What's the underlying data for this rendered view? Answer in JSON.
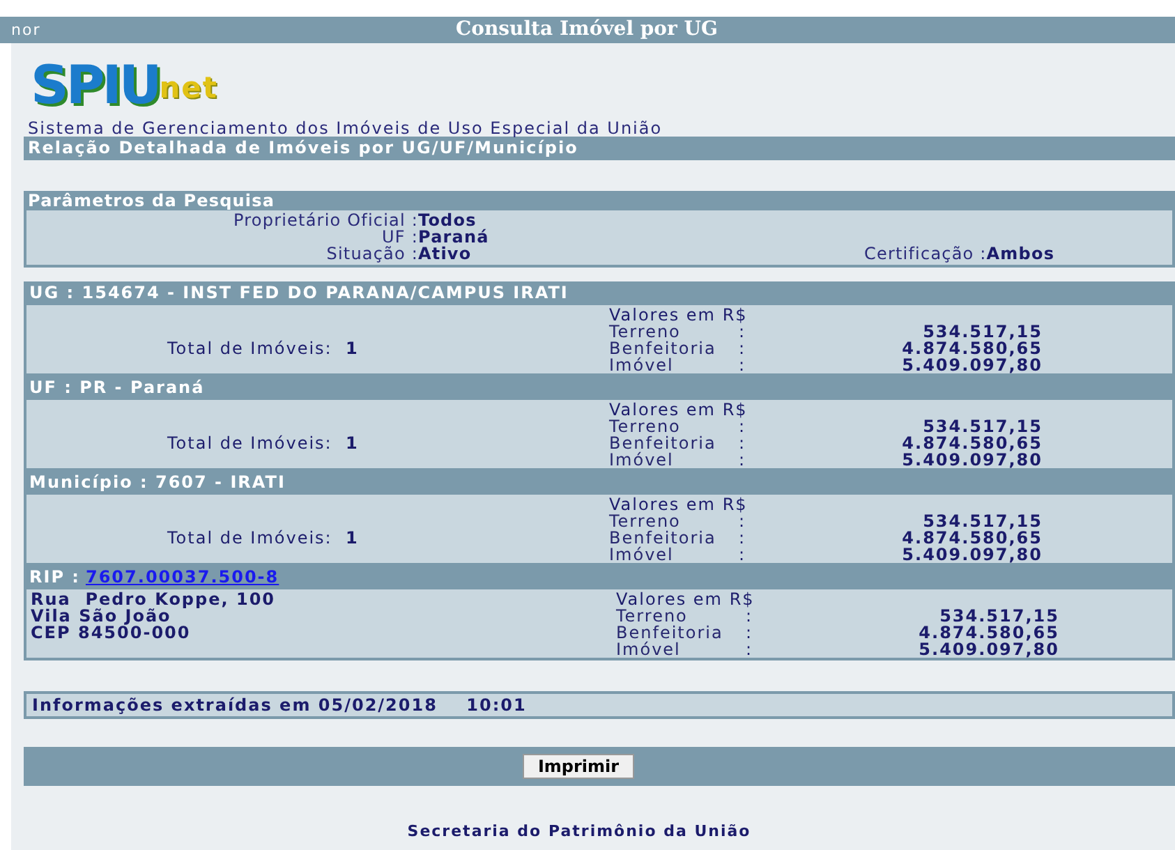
{
  "window": {
    "title_left": "nor",
    "title": "Consulta Imóvel por UG"
  },
  "logo": {
    "main": "SPIU",
    "suffix": "net"
  },
  "system_name": "Sistema de Gerenciamento dos Imóveis de Uso Especial da União",
  "report_title": "Relação Detalhada de Imóveis por UG/UF/Município",
  "parameters": {
    "title": "Parâmetros da Pesquisa",
    "fields": [
      {
        "label": "Proprietário Oficial :",
        "value": "Todos"
      },
      {
        "label": "UF :",
        "value": "Paraná"
      },
      {
        "label": "Situação :",
        "value": "Ativo"
      }
    ],
    "certification": {
      "label": "Certificação :",
      "value": "Ambos"
    }
  },
  "groups": [
    {
      "kind": "summary",
      "heading": "UG : 154674 - INST FED DO PARANA/CAMPUS IRATI",
      "total_label": "Total de Imóveis:",
      "total": "1",
      "values_title": "Valores em R$",
      "values": [
        {
          "label": "Terreno",
          "sep": ":",
          "value": "534.517,15"
        },
        {
          "label": "Benfeitoria",
          "sep": ":",
          "value": "4.874.580,65"
        },
        {
          "label": "Imóvel",
          "sep": ":",
          "value": "5.409.097,80"
        }
      ]
    },
    {
      "kind": "summary",
      "heading": "UF : PR - Paraná",
      "total_label": "Total de Imóveis:",
      "total": "1",
      "values_title": "Valores em R$",
      "values": [
        {
          "label": "Terreno",
          "sep": ":",
          "value": "534.517,15"
        },
        {
          "label": "Benfeitoria",
          "sep": ":",
          "value": "4.874.580,65"
        },
        {
          "label": "Imóvel",
          "sep": ":",
          "value": "5.409.097,80"
        }
      ]
    },
    {
      "kind": "summary",
      "heading": "Município : 7607 - IRATI",
      "total_label": "Total de Imóveis:",
      "total": "1",
      "values_title": "Valores em R$",
      "values": [
        {
          "label": "Terreno",
          "sep": ":",
          "value": "534.517,15"
        },
        {
          "label": "Benfeitoria",
          "sep": ":",
          "value": "4.874.580,65"
        },
        {
          "label": "Imóvel",
          "sep": ":",
          "value": "5.409.097,80"
        }
      ]
    },
    {
      "kind": "property",
      "heading": "RIP :",
      "link": "7607.00037.500-8",
      "address": [
        "Rua  Pedro Koppe, 100",
        "Vila São João",
        "CEP 84500-000"
      ],
      "values_title": "Valores em R$",
      "values": [
        {
          "label": "Terreno",
          "sep": ":",
          "value": "534.517,15"
        },
        {
          "label": "Benfeitoria",
          "sep": ":",
          "value": "4.874.580,65"
        },
        {
          "label": "Imóvel",
          "sep": ":",
          "value": "5.409.097,80"
        }
      ]
    }
  ],
  "extracted": "Informações extraídas em 05/02/2018    10:01",
  "print_button": "Imprimir",
  "footer": "Secretaria do Patrimônio da União"
}
